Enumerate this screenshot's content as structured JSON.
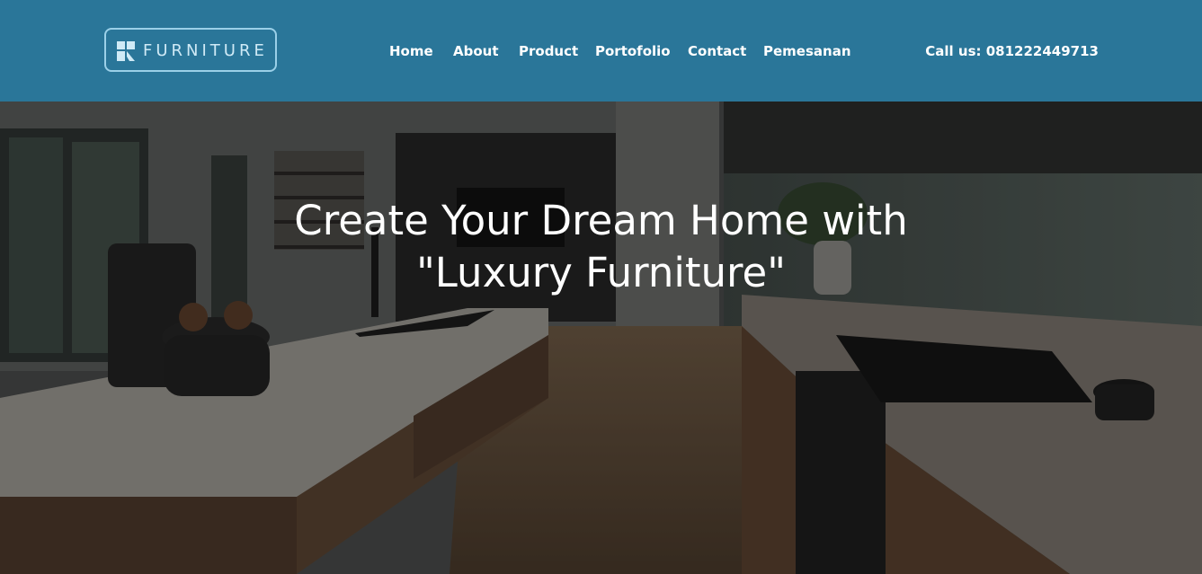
{
  "brand": {
    "name": "FURNITURE"
  },
  "nav": {
    "items": [
      {
        "label": "Home"
      },
      {
        "label": "About"
      },
      {
        "label": "Product"
      },
      {
        "label": "Portofolio"
      },
      {
        "label": "Contact"
      },
      {
        "label": "Pemesanan"
      }
    ]
  },
  "contact": {
    "call_label": "Call us: 081222449713"
  },
  "hero": {
    "title_line1": "Create Your Dream Home with",
    "title_line2": "\"Luxury Furniture\""
  },
  "colors": {
    "header_bg": "#2a7699",
    "logo_border": "#9bd0e8",
    "text": "#ffffff"
  }
}
